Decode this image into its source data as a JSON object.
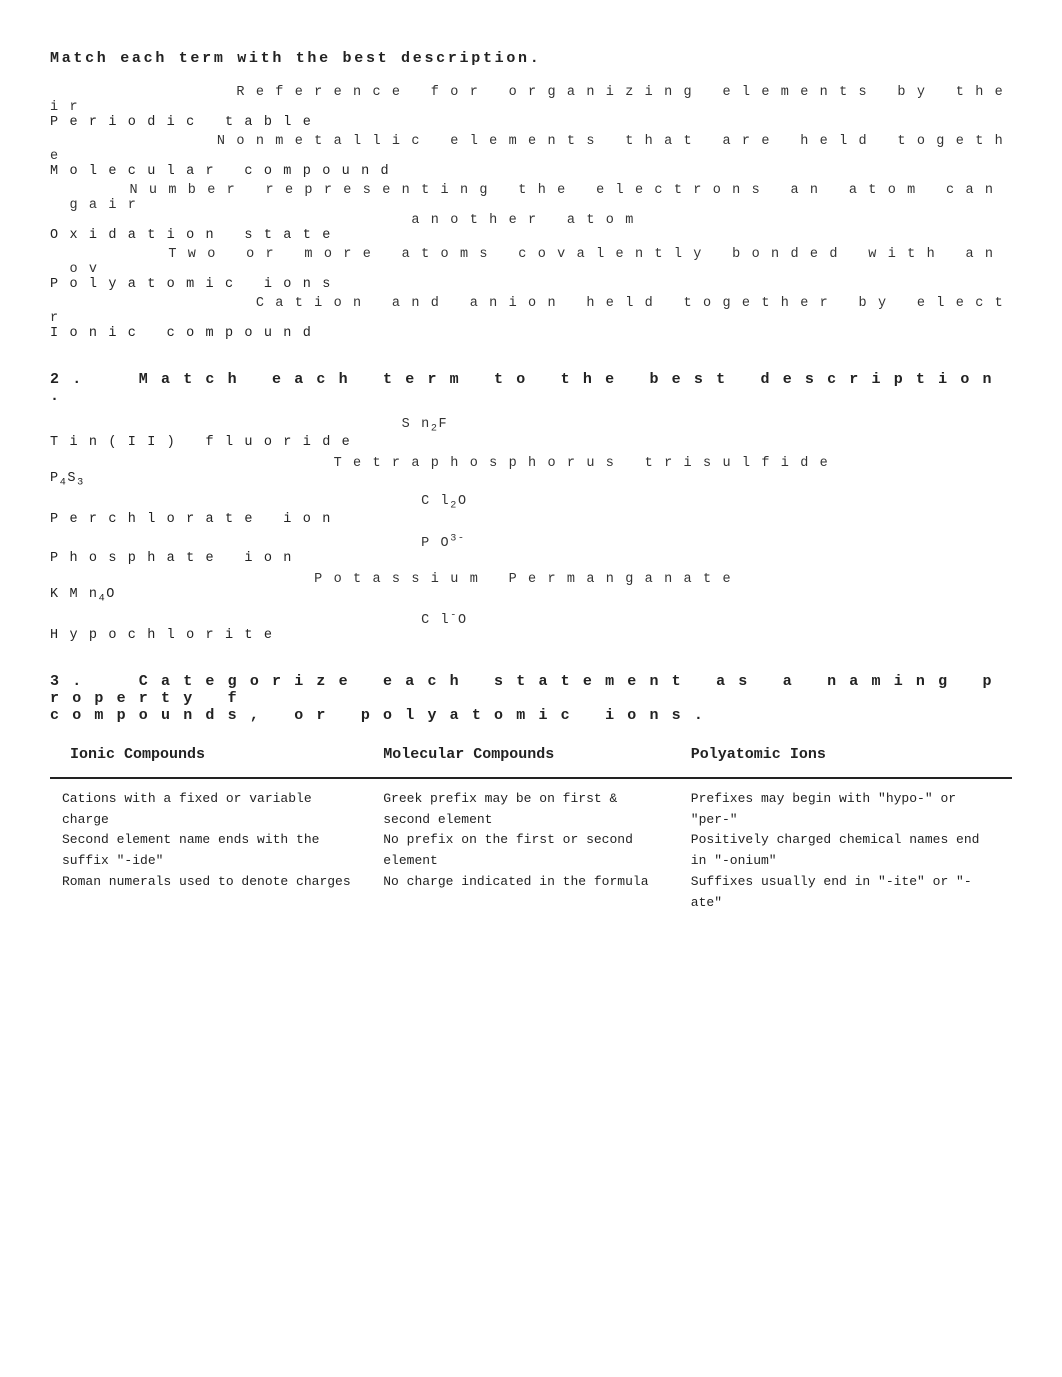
{
  "section1": {
    "title": "Match each term with the best description.",
    "items": [
      {
        "description": "Reference for organizing elements by their",
        "continuation": "Periodic table",
        "term": "Periodic table"
      },
      {
        "description": "Nonmetallic elements that are held togethe",
        "continuation": "Molecular compound",
        "term": "Molecular compound"
      },
      {
        "description": "Number representing the electrons an atom can gair",
        "continuation": "another atom",
        "term": "Oxidation state"
      },
      {
        "description": "Two or more atoms covalently bonded with an ov",
        "continuation": "",
        "term": "Polyatomic ions"
      },
      {
        "description": "Cation and anion held together by electr",
        "continuation": "",
        "term": "Ionic compound"
      }
    ]
  },
  "section2": {
    "title": "2.   Match each term to the best description.",
    "items": [
      {
        "formula": "Sn₂F",
        "term": "Tin(II) fluoride"
      },
      {
        "formula": "Tetraphosphorus trisulfide",
        "term": "P₄S₃"
      },
      {
        "formula": "Cl₂O",
        "term": "Perchlorate ion"
      },
      {
        "formula": "PO⁴³⁻",
        "term": "Phosphate ion"
      },
      {
        "formula": "Potassium Permanganate",
        "term": "KMnO₄"
      },
      {
        "formula": "Cl⁻O",
        "term": "Hypochlorite"
      }
    ]
  },
  "section3": {
    "title": "3.   Categorize each statement as a naming property f",
    "subtitle": "compounds, or polyatomic ions.",
    "columns": [
      {
        "header": "Ionic Compounds",
        "content": "Cations with a fixed or variable chargeSecond element name ends with the suffix \"-ide\"Roman numerals used to denote charges"
      },
      {
        "header": "Molecular Compounds",
        "content": "Greek prefix may be on first & second elementNo prefix on the first or second elementNo charge indicated in the formula"
      },
      {
        "header": "Polyatomic Ions",
        "content": "Prefixes may begin with \"hypo-\" or \"per-\"Positively charged chemical names end in \"-onium\"Suffixes usually end in \"-ite\" or \"-ate\""
      }
    ]
  }
}
